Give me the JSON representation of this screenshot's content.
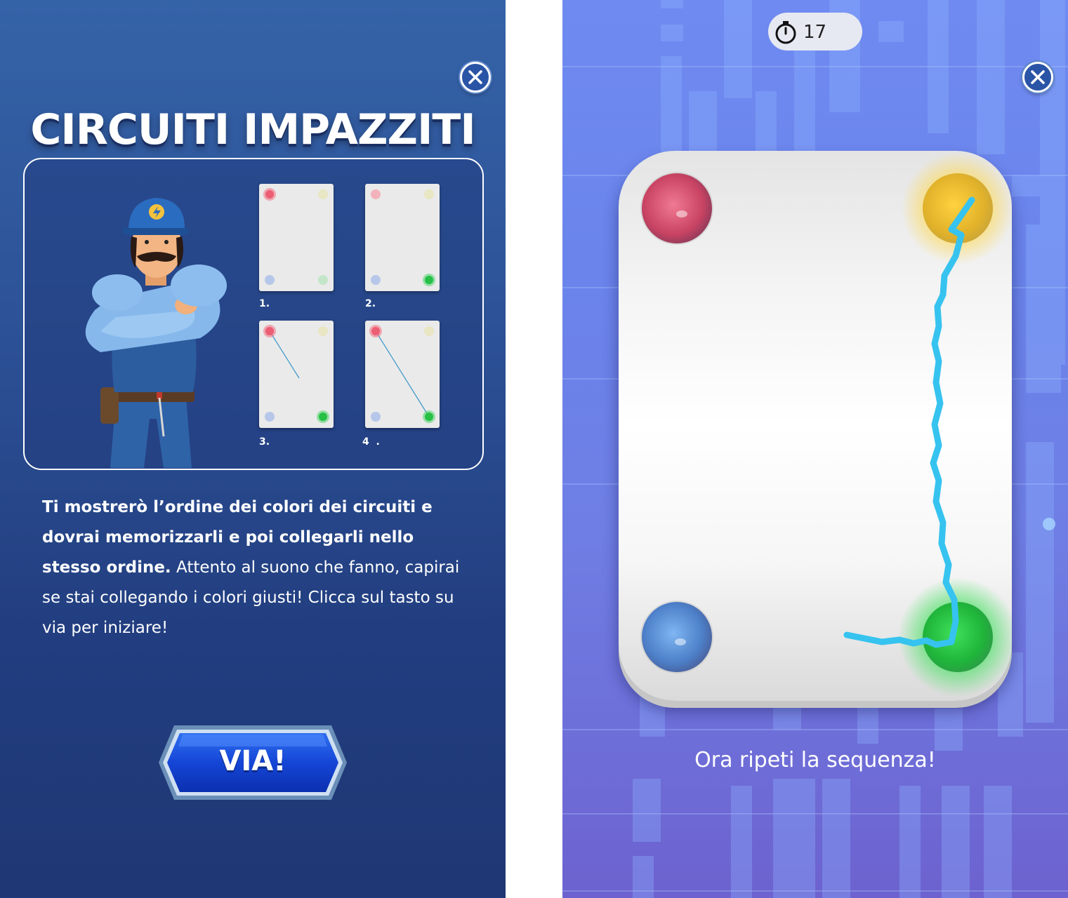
{
  "intro_screen": {
    "title": "CIRCUITI IMPAZZITI",
    "close_icon": "close-x-icon",
    "tutorial_steps": [
      {
        "label": "1.",
        "lit": [
          "red",
          "yellow",
          "blue",
          "green"
        ],
        "line": "none"
      },
      {
        "label": "2.",
        "lit": [
          "red",
          "yellow",
          "blue",
          "green"
        ],
        "line": "none"
      },
      {
        "label": "3.",
        "lit": [
          "red",
          "yellow",
          "blue",
          "green"
        ],
        "line": "partial"
      },
      {
        "label": "4  .",
        "lit": [
          "red",
          "yellow",
          "blue",
          "green"
        ],
        "line": "full"
      }
    ],
    "instructions_bold": "Ti mostrerò l’ordine dei colori dei circuiti e dovrai memorizzarli e poi collegarli nello stesso ordine.",
    "instructions_regular": " Attento al suono che fanno, capirai se stai collegando i colori giusti! Clicca sul tasto su via per iniziare!",
    "start_button_label": "VIA!"
  },
  "game_screen": {
    "timer_icon": "stopwatch-icon",
    "timer_value": "17",
    "close_icon": "close-x-icon",
    "nodes": [
      "red",
      "yellow",
      "blue",
      "green"
    ],
    "prompt": "Ora ripeti la sequenza!"
  },
  "colors": {
    "red": "#e0476b",
    "yellow": "#f2c12e",
    "blue": "#5b8fd6",
    "green": "#22c23f",
    "wire": "#36c3ef"
  }
}
